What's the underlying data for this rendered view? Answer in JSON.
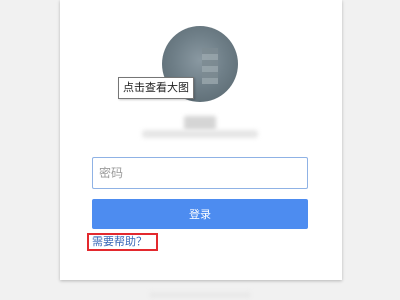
{
  "tooltip": {
    "text": "点击查看大图"
  },
  "password": {
    "placeholder": "密码",
    "value": ""
  },
  "login": {
    "label": "登录"
  },
  "help": {
    "label": "需要帮助？"
  },
  "colors": {
    "primary_button": "#4d8cf0",
    "link": "#3867b6",
    "highlight_box": "#e3292e",
    "input_border": "#8fb2e5"
  }
}
